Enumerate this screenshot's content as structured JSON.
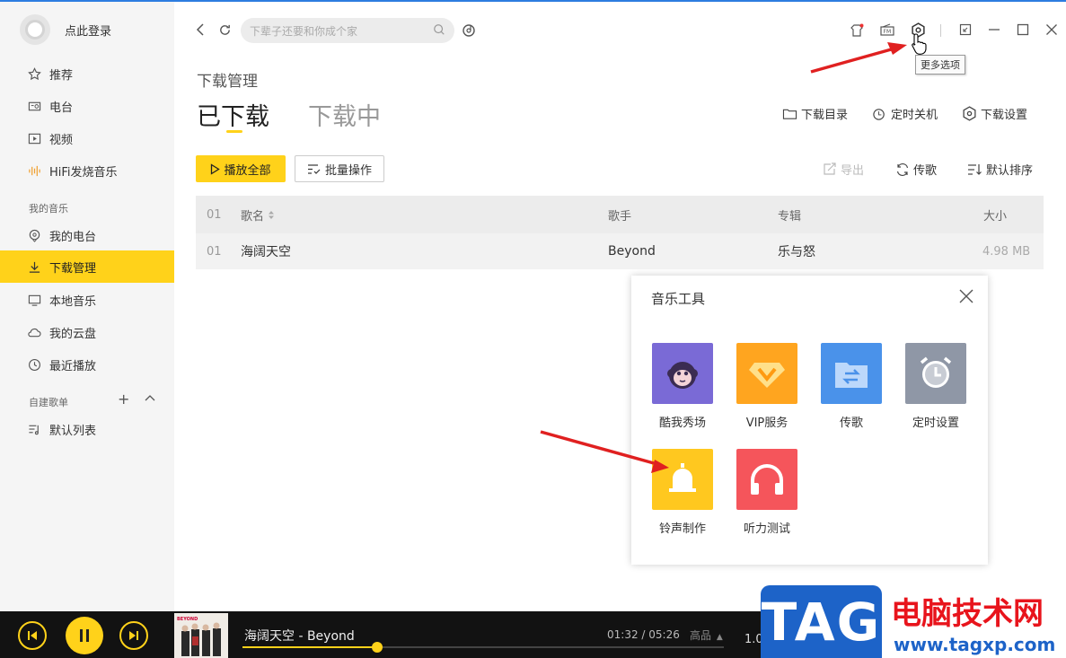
{
  "sidebar": {
    "login": "点此登录",
    "items_top": [
      "推荐",
      "电台",
      "视频",
      "HiFi发烧音乐"
    ],
    "section_my_music": "我的音乐",
    "items_my": [
      "我的电台",
      "下载管理",
      "本地音乐",
      "我的云盘",
      "最近播放"
    ],
    "section_playlists": "自建歌单",
    "playlist_add": "+",
    "playlist_collapse": "⌃",
    "playlists": [
      "默认列表"
    ]
  },
  "topbar": {
    "search_placeholder": "下辈子还要和你成个家",
    "tooltip": "更多选项"
  },
  "main": {
    "breadcrumb": "下载管理",
    "tabs": [
      "已下载",
      "下载中"
    ],
    "links": [
      "下载目录",
      "定时关机",
      "下载设置"
    ],
    "play_all": "播放全部",
    "batch": "批量操作",
    "export": "导出",
    "transfer": "传歌",
    "sort": "默认排序"
  },
  "table": {
    "header": {
      "num": "01",
      "song": "歌名",
      "artist": "歌手",
      "album": "专辑",
      "size": "大小"
    },
    "rows": [
      {
        "num": "01",
        "song": "海阔天空",
        "artist": "Beyond",
        "album": "乐与怒",
        "size": "4.98 MB"
      }
    ]
  },
  "popup": {
    "title": "音乐工具",
    "tools": [
      {
        "label": "酷我秀场",
        "color": "#7a6ad6"
      },
      {
        "label": "VIP服务",
        "color": "#ffa51f"
      },
      {
        "label": "传歌",
        "color": "#4a92ea"
      },
      {
        "label": "定时设置",
        "color": "#8f97a6"
      },
      {
        "label": "铃声制作",
        "color": "#ffc81f"
      },
      {
        "label": "听力测试",
        "color": "#f5555b"
      }
    ]
  },
  "player": {
    "song": "海阔天空 - Beyond",
    "time": "01:32 / 05:26",
    "quality": "高品",
    "speed": "1.0",
    "progress": 0.28,
    "cover_text": "BEYOND"
  },
  "watermark": {
    "tag": "TAG",
    "site_cn": "电脑技术网",
    "url": "www.tagxp.com"
  },
  "colors": {
    "accent": "#ffd21a",
    "arrow": "#e02020"
  }
}
